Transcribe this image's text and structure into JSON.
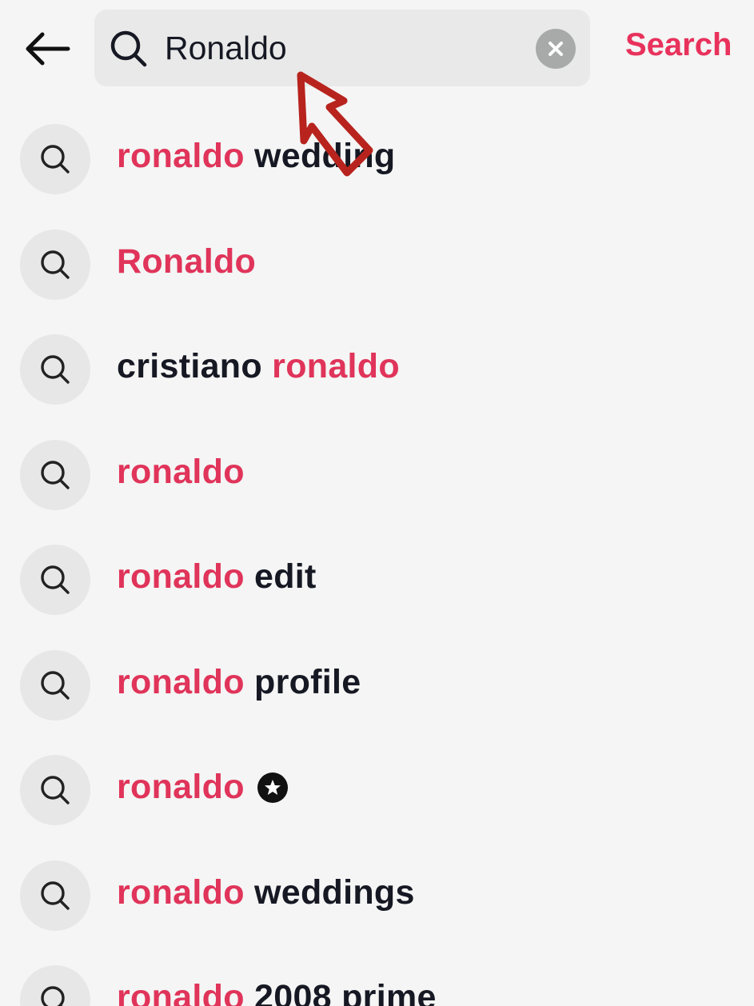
{
  "header": {
    "back_icon": "arrow-left-icon",
    "search_icon": "search-icon",
    "query": "Ronaldo",
    "clear_icon": "close-icon",
    "search_label": "Search",
    "accent_color": "#e8325c"
  },
  "suggestions": [
    {
      "highlight_before": "",
      "prefix": "",
      "highlight": "ronaldo",
      "suffix": " wedding"
    },
    {
      "prefix": "",
      "highlight": "Ronaldo",
      "suffix": ""
    },
    {
      "prefix": "cristiano ",
      "highlight": "ronaldo",
      "suffix": ""
    },
    {
      "prefix": "",
      "highlight": "ronaldo",
      "suffix": ""
    },
    {
      "prefix": "",
      "highlight": "ronaldo",
      "suffix": " edit"
    },
    {
      "prefix": "",
      "highlight": "ronaldo",
      "suffix": " profile"
    },
    {
      "prefix": "",
      "highlight": "ronaldo",
      "suffix": " ",
      "badge_icon": "star-badge-icon"
    },
    {
      "prefix": "",
      "highlight": "ronaldo",
      "suffix": " weddings"
    },
    {
      "prefix": "",
      "highlight": "ronaldo",
      "suffix": " 2008 prime"
    }
  ]
}
